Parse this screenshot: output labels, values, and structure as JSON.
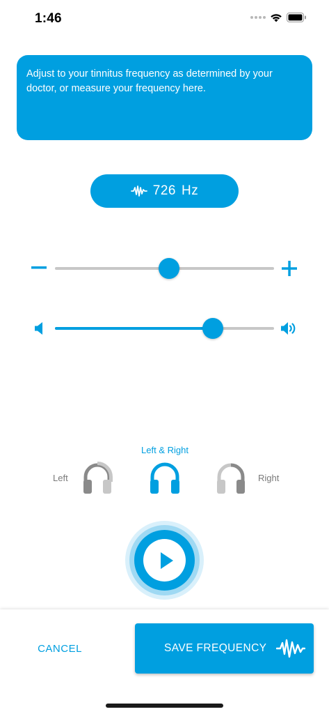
{
  "status_bar": {
    "time": "1:46"
  },
  "info_banner": {
    "text": "Adjust to your tinnitus frequency as determined by your doctor, or measure your frequency here."
  },
  "frequency": {
    "value": "726",
    "unit": "Hz"
  },
  "frequency_slider": {
    "position_fraction": 0.52
  },
  "volume_slider": {
    "position_fraction": 0.72
  },
  "ear_selector": {
    "left_label": "Left",
    "both_label": "Left & Right",
    "right_label": "Right",
    "selected": "both"
  },
  "actions": {
    "cancel_label": "CANCEL",
    "save_label": "SAVE FREQUENCY"
  },
  "colors": {
    "accent": "#009fe0",
    "inactive": "#8e8e8e"
  },
  "icons": [
    "wifi-icon",
    "battery-icon",
    "waveform-icon",
    "minus-icon",
    "plus-icon",
    "volume-low-icon",
    "volume-high-icon",
    "headphones-icon",
    "play-icon"
  ]
}
